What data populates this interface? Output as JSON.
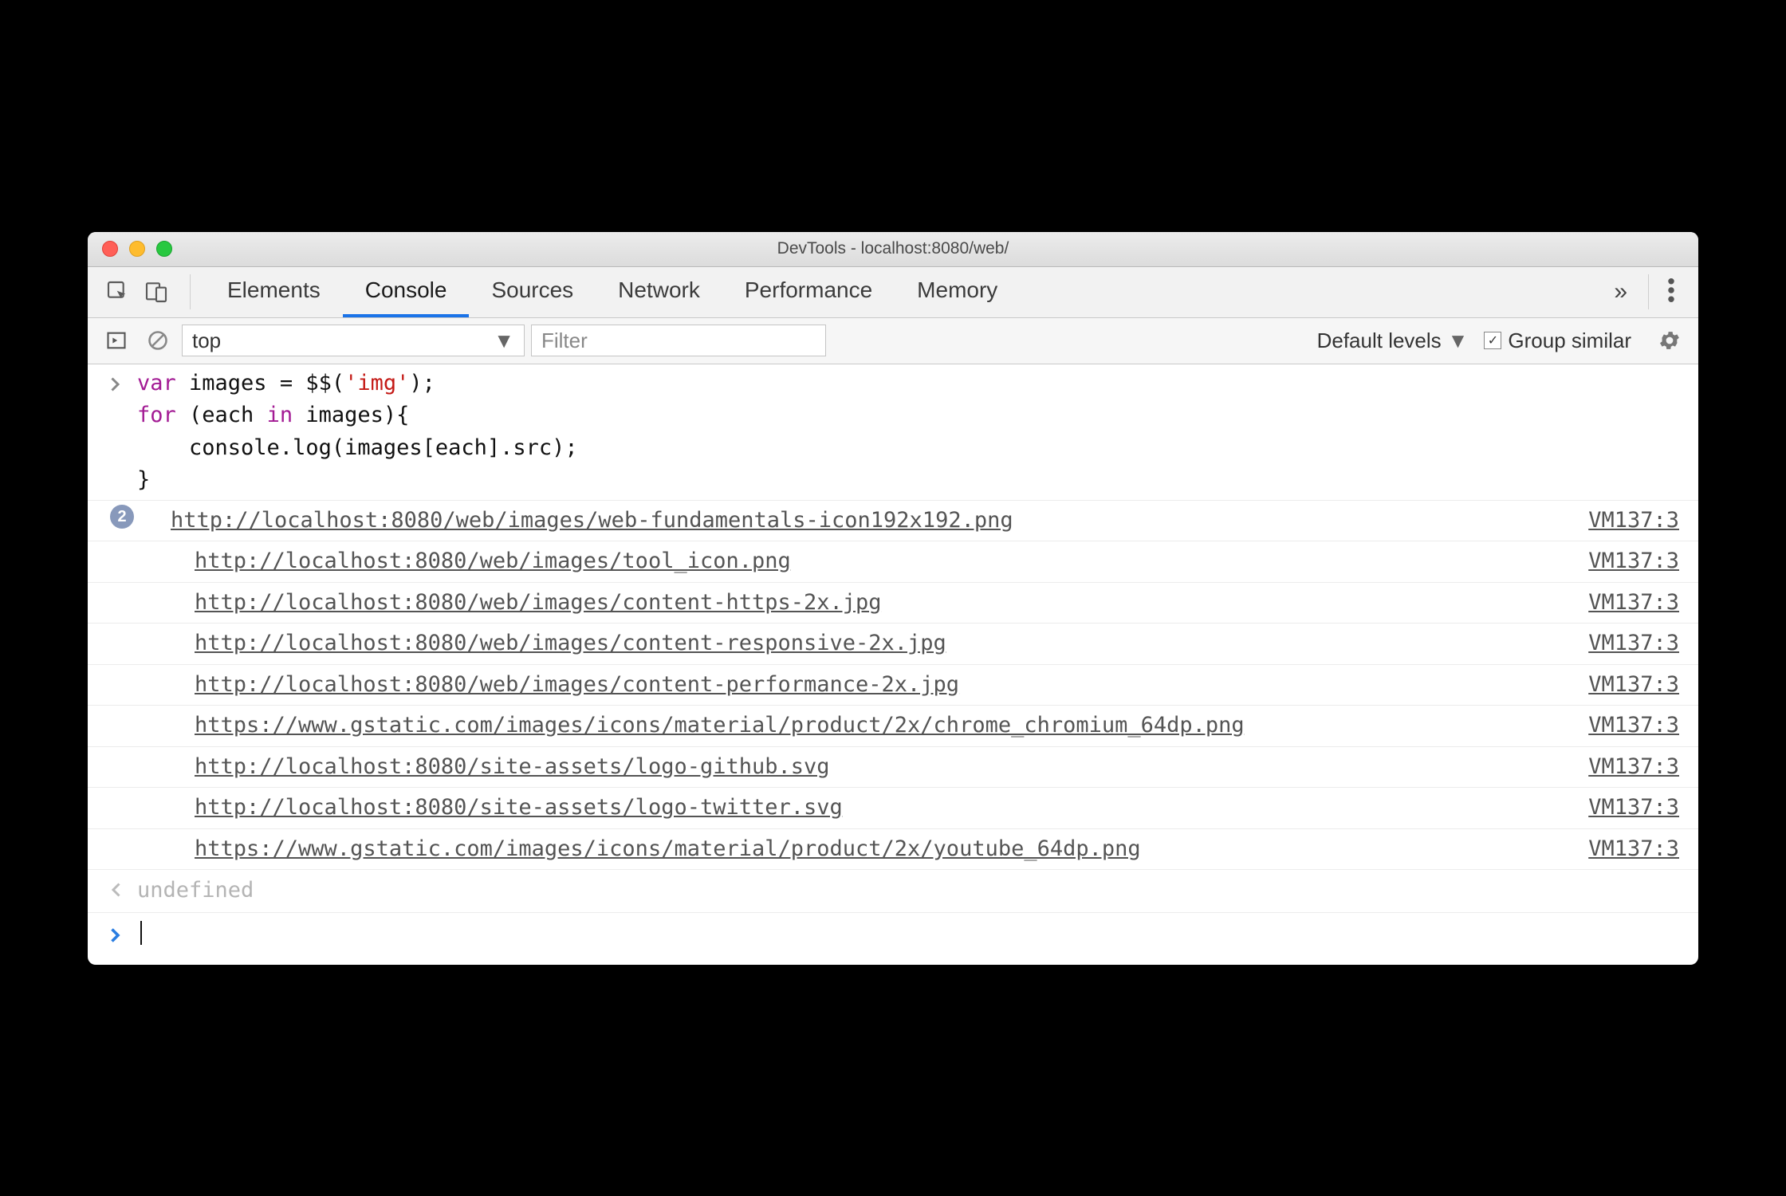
{
  "window": {
    "title": "DevTools - localhost:8080/web/"
  },
  "tabs": {
    "items": [
      "Elements",
      "Console",
      "Sources",
      "Network",
      "Performance",
      "Memory"
    ],
    "active_index": 1
  },
  "toolbar": {
    "context": "top",
    "filter_placeholder": "Filter",
    "levels_label": "Default levels",
    "group_similar_label": "Group similar",
    "group_similar_checked": true
  },
  "code": {
    "lines": [
      [
        {
          "t": "var ",
          "c": "kw"
        },
        {
          "t": "images",
          "c": "op"
        },
        {
          "t": " = ",
          "c": "op"
        },
        {
          "t": "$$",
          "c": "fn"
        },
        {
          "t": "(",
          "c": "op"
        },
        {
          "t": "'img'",
          "c": "str"
        },
        {
          "t": ");",
          "c": "op"
        }
      ],
      [
        {
          "t": "for ",
          "c": "kw"
        },
        {
          "t": "(each ",
          "c": "op"
        },
        {
          "t": "in ",
          "c": "kw"
        },
        {
          "t": "images){",
          "c": "op"
        }
      ],
      [
        {
          "t": "    console.log(images[each].src);",
          "c": "op"
        }
      ],
      [
        {
          "t": "}",
          "c": "op"
        }
      ]
    ]
  },
  "logs": [
    {
      "badge": "2",
      "url": "http://localhost:8080/web/images/web-fundamentals-icon192x192.png",
      "src": "VM137:3"
    },
    {
      "url": "http://localhost:8080/web/images/tool_icon.png",
      "src": "VM137:3"
    },
    {
      "url": "http://localhost:8080/web/images/content-https-2x.jpg",
      "src": "VM137:3"
    },
    {
      "url": "http://localhost:8080/web/images/content-responsive-2x.jpg",
      "src": "VM137:3"
    },
    {
      "url": "http://localhost:8080/web/images/content-performance-2x.jpg",
      "src": "VM137:3"
    },
    {
      "url": "https://www.gstatic.com/images/icons/material/product/2x/chrome_chromium_64dp.png",
      "src": "VM137:3"
    },
    {
      "url": "http://localhost:8080/site-assets/logo-github.svg",
      "src": "VM137:3"
    },
    {
      "url": "http://localhost:8080/site-assets/logo-twitter.svg",
      "src": "VM137:3"
    },
    {
      "url": "https://www.gstatic.com/images/icons/material/product/2x/youtube_64dp.png",
      "src": "VM137:3"
    }
  ],
  "return_value": "undefined"
}
